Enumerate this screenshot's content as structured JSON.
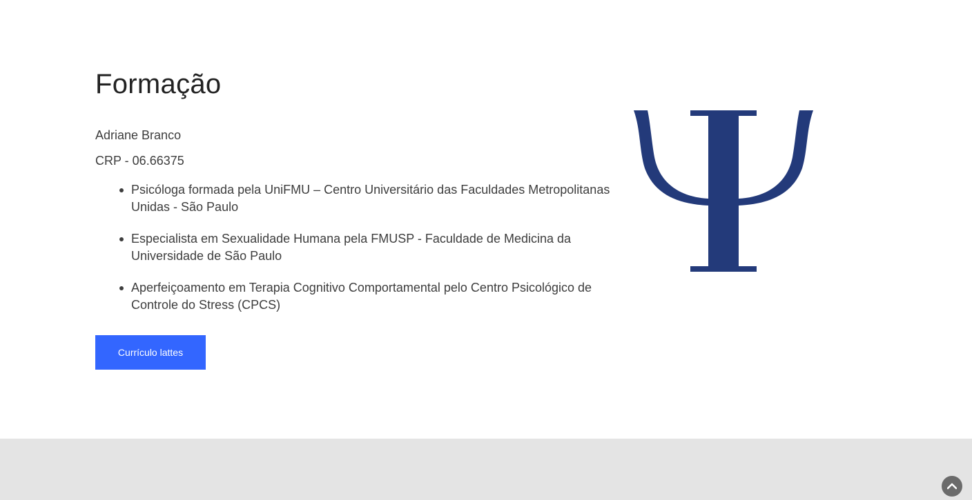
{
  "section": {
    "title": "Formação",
    "name": "Adriane Branco",
    "crp": "CRP - 06.66375",
    "items": [
      {
        "text": "Psicóloga formada pela UniFMU – Centro Universitário das Faculdades Metropolitanas Unidas - São Paulo"
      },
      {
        "text": "Especialista em Sexualidade Humana pela FMUSP - Faculdade de Medicina da Universidade de São Paulo"
      },
      {
        "text": "Aperfeiçoamento em Terapia Cognitivo Comportamental pelo Centro Psicológico de Controle do Stress (CPCS)"
      }
    ],
    "button_label": "Currículo lattes"
  },
  "icons": {
    "logo": "psi-symbol-icon",
    "scroll_top": "chevron-up-icon"
  },
  "colors": {
    "accent": "#3366ff",
    "psi": "#233a7a",
    "footer_bg": "#e4e4e4"
  }
}
